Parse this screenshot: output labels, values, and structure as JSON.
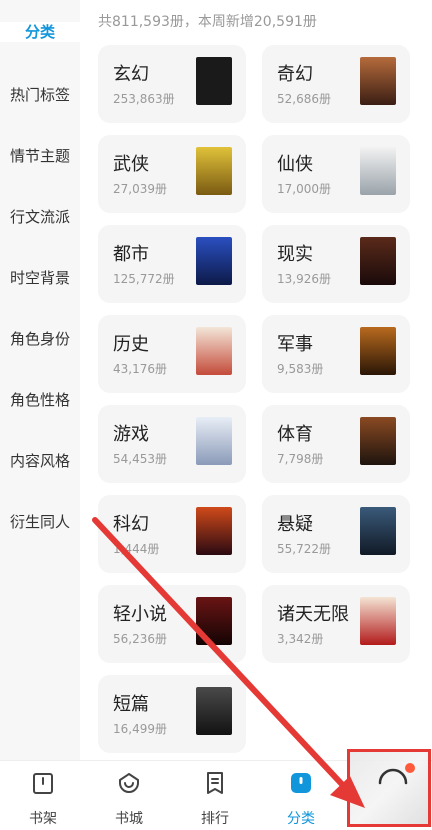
{
  "sidebar": {
    "items": [
      {
        "label": "分类",
        "active": true
      },
      {
        "label": "热门标签"
      },
      {
        "label": "情节主题"
      },
      {
        "label": "行文流派"
      },
      {
        "label": "时空背景"
      },
      {
        "label": "角色身份"
      },
      {
        "label": "角色性格"
      },
      {
        "label": "内容风格"
      },
      {
        "label": "衍生同人"
      }
    ]
  },
  "summary": "共811,593册，本周新增20,591册",
  "categories": [
    {
      "name": "玄幻",
      "count": "253,863册",
      "cover_color": "#1a1a1a"
    },
    {
      "name": "奇幻",
      "count": "52,686册",
      "cover_color": "#6b3a2a"
    },
    {
      "name": "武侠",
      "count": "27,039册",
      "cover_color": "#c9a227"
    },
    {
      "name": "仙侠",
      "count": "17,000册",
      "cover_color": "#e9e9e9"
    },
    {
      "name": "都市",
      "count": "125,772册",
      "cover_color": "#1f3b8f"
    },
    {
      "name": "现实",
      "count": "13,926册",
      "cover_color": "#3a1d1d"
    },
    {
      "name": "历史",
      "count": "43,176册",
      "cover_color": "#e8d6c6"
    },
    {
      "name": "军事",
      "count": "9,583册",
      "cover_color": "#6a3b12"
    },
    {
      "name": "游戏",
      "count": "54,453册",
      "cover_color": "#b8c6d8"
    },
    {
      "name": "体育",
      "count": "7,798册",
      "cover_color": "#3d2a1e"
    },
    {
      "name": "科幻",
      "count": "1,444册",
      "cover_color": "#3a1a2a"
    },
    {
      "name": "悬疑",
      "count": "55,722册",
      "cover_color": "#233044"
    },
    {
      "name": "轻小说",
      "count": "56,236册",
      "cover_color": "#2a0d0d"
    },
    {
      "name": "诸天无限",
      "count": "3,342册",
      "cover_color": "#b21b1b"
    },
    {
      "name": "短篇",
      "count": "16,499册",
      "cover_color": "#2b2b2b"
    }
  ],
  "tabs": [
    {
      "label": "书架",
      "icon": "bookshelf-icon"
    },
    {
      "label": "书城",
      "icon": "store-icon"
    },
    {
      "label": "排行",
      "icon": "ranking-icon"
    },
    {
      "label": "分类",
      "icon": "category-icon",
      "active": true
    }
  ],
  "colors": {
    "accent": "#1296db",
    "annotation": "#e53935"
  }
}
